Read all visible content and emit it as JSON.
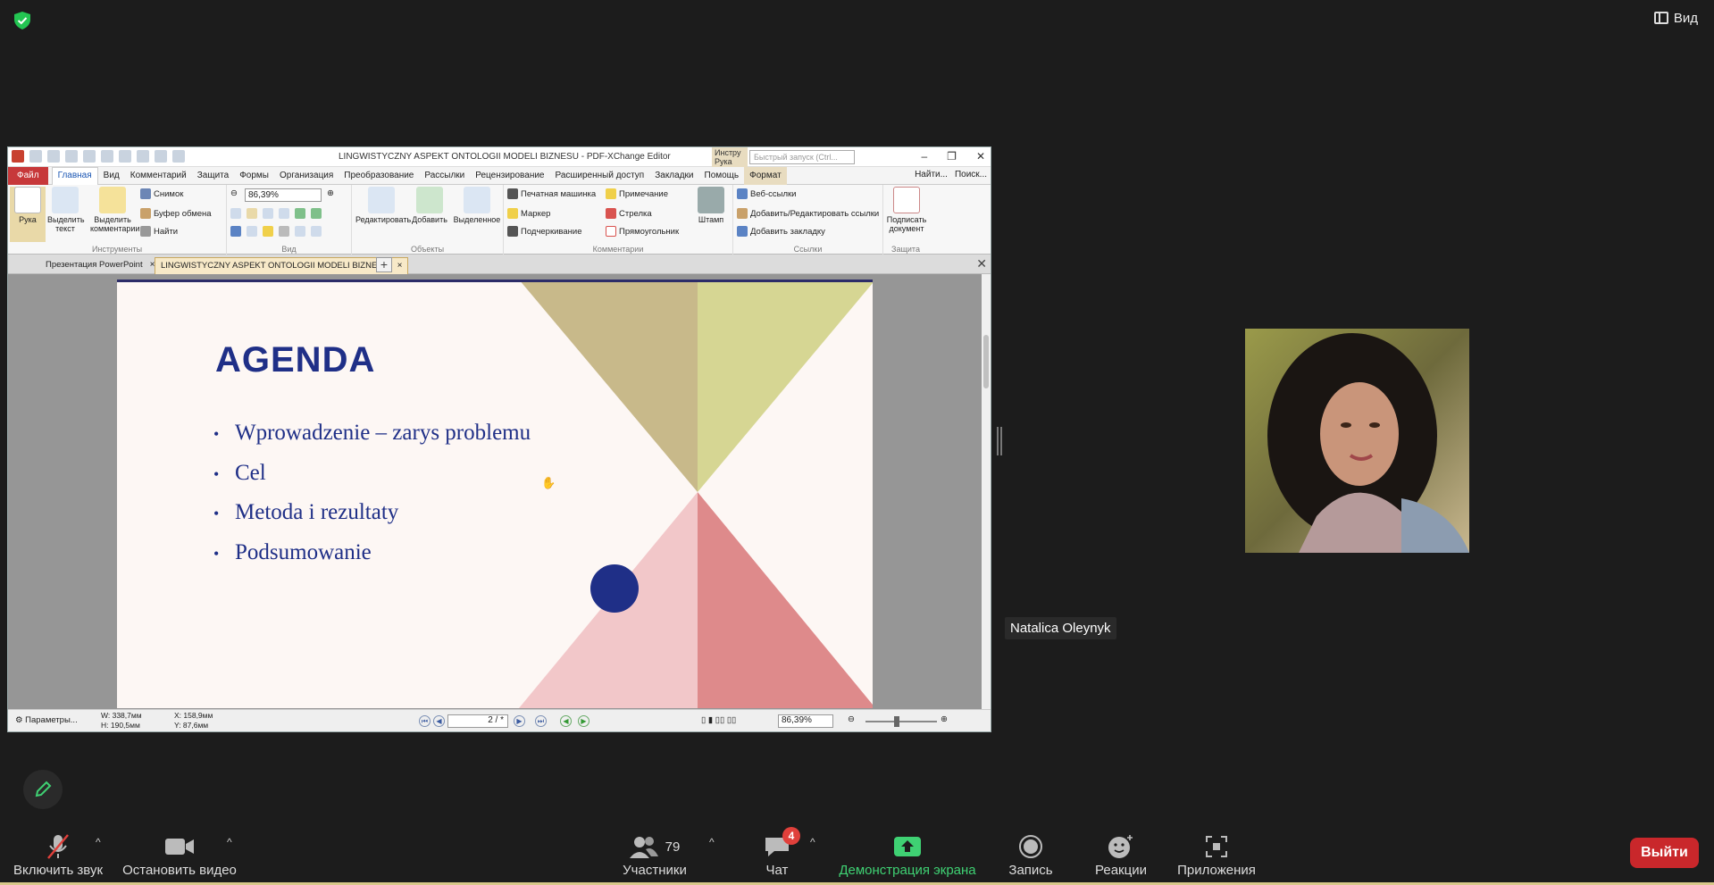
{
  "top_bar": {
    "view_label": "Вид"
  },
  "pdf_editor": {
    "window_title": "LINGWISTYCZNY ASPEKT ONTOLOGII MODELI BIZNESU - PDF-XChange Editor",
    "tools_tab": "Инстру Рука",
    "quick_search_placeholder": "Быстрый запуск (Ctrl...",
    "menu": {
      "file": "Файл",
      "items": [
        "Главная",
        "Вид",
        "Комментарий",
        "Защита",
        "Формы",
        "Организация",
        "Преобразование",
        "Рассылки",
        "Рецензирование",
        "Расширенный доступ",
        "Закладки",
        "Помощь"
      ],
      "format": "Формат",
      "find": "Найти...",
      "search": "Поиск..."
    },
    "ribbon": {
      "hand": "Рука",
      "select_text": "Выделить текст",
      "select_comments": "Выделить комментарии",
      "snapshot": "Снимок",
      "clipboard": "Буфер обмена",
      "find": "Найти",
      "group_tools": "Инструменты",
      "zoom": "86,39%",
      "group_view": "Вид",
      "edit": "Редактировать",
      "add": "Добавить",
      "selected": "Выделенное",
      "group_objects": "Объекты",
      "typewriter": "Печатная машинка",
      "note": "Примечание",
      "marker": "Маркер",
      "arrow": "Стрелка",
      "underline": "Подчеркивание",
      "rectangle": "Прямоугольник",
      "stamp": "Штамп",
      "group_comments": "Комментарии",
      "web_links": "Веб-ссылки",
      "add_edit_links": "Добавить/Редактировать ссылки",
      "add_bookmark": "Добавить закладку",
      "group_links": "Ссылки",
      "sign_doc": "Подписать документ",
      "group_protect": "Защита"
    },
    "tabs": [
      {
        "label": "Презентация PowerPoint"
      },
      {
        "label": "LINGWISTYCZNY ASPEKT ONTOLOGII MODELI BIZNES..."
      }
    ],
    "slide": {
      "title": "AGENDA",
      "bullets": [
        "Wprowadzenie – zarys problemu",
        "Cel",
        "Metoda i rezultaty",
        "Podsumowanie"
      ],
      "colors": {
        "title": "#1f2f87",
        "tan": "#c8b98a",
        "olive": "#d6d693",
        "pink": "#f2c7c9",
        "rose": "#de8a8b",
        "dot": "#1f2f87"
      }
    },
    "status": {
      "params": "Параметры...",
      "w": "W: 338,7мм",
      "h": "H: 190,5мм",
      "x": "X: 158,9мм",
      "y": "Y: 87,6мм",
      "page": "2 / *",
      "zoom": "86,39%"
    }
  },
  "participant": {
    "name": "Natalica Oleynyk"
  },
  "toolbar": {
    "unmute": "Включить звук",
    "stop_video": "Остановить видео",
    "participants_count": "79",
    "participants": "Участники",
    "chat_badge": "4",
    "chat": "Чат",
    "share_screen": "Демонстрация экрана",
    "record": "Запись",
    "reactions": "Реакции",
    "apps": "Приложения",
    "leave": "Выйти"
  }
}
